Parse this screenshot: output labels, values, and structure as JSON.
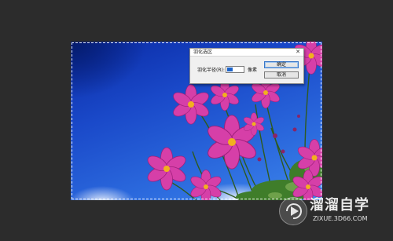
{
  "dialog": {
    "title": "羽化选区",
    "close_glyph": "✕",
    "radius_label": "羽化半径(R):",
    "radius_value": "",
    "unit_label": "像素",
    "ok_label": "确定",
    "cancel_label": "取消"
  },
  "watermark": {
    "brand": "溜溜自学",
    "url": "ZIXUE.3D66.COM"
  },
  "colors": {
    "workspace": "#2c2c2c",
    "sky": "#1a49c9",
    "petal": "#d63fa8",
    "flower_center": "#f2b01e",
    "selection_accent": "#1c63c9"
  },
  "icons": {
    "close": "close-icon",
    "logo": "play-logo-icon"
  }
}
